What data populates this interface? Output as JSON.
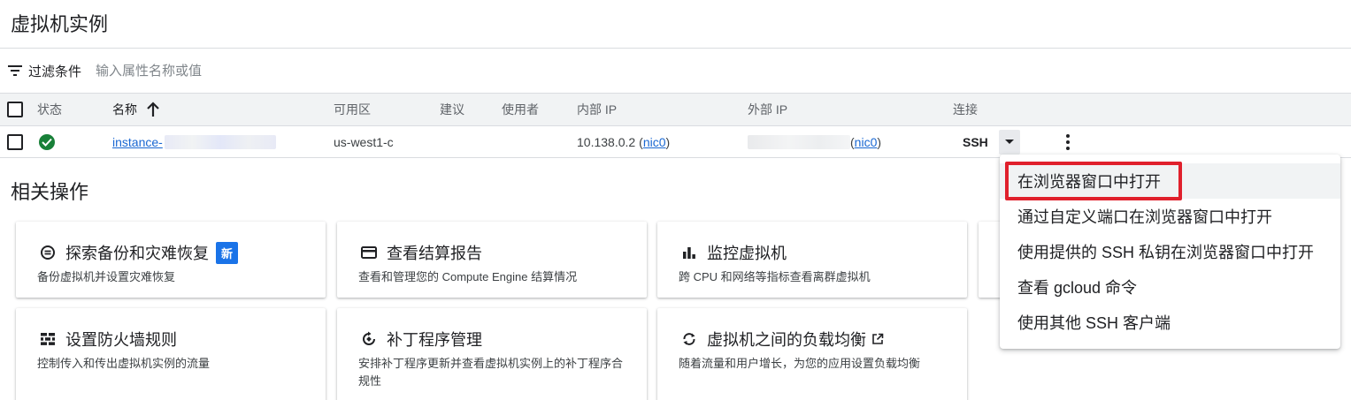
{
  "page": {
    "title": "虚拟机实例"
  },
  "filter": {
    "label": "过滤条件",
    "placeholder": "输入属性名称或值"
  },
  "table": {
    "headers": {
      "status": "状态",
      "name": "名称",
      "zone": "可用区",
      "recommendation": "建议",
      "in_use_by": "使用者",
      "internal_ip": "内部 IP",
      "external_ip": "外部 IP",
      "connect": "连接"
    },
    "rows": [
      {
        "name": "instance-",
        "zone": "us-west1-c",
        "internal_ip": "10.138.0.2",
        "internal_nic": "nic0",
        "external_nic": "nic0",
        "connect": "SSH"
      }
    ]
  },
  "related": {
    "title": "相关操作",
    "cards": [
      {
        "title": "探索备份和灾难恢复",
        "badge": "新",
        "desc": "备份虚拟机并设置灾难恢复",
        "icon": "backup-icon"
      },
      {
        "title": "查看结算报告",
        "desc": "查看和管理您的 Compute Engine 结算情况",
        "icon": "credit-card-icon"
      },
      {
        "title": "监控虚拟机",
        "desc": "跨 CPU 和网络等指标查看离群虚拟机",
        "icon": "bar-chart-icon"
      },
      {
        "title": "设置防火墙规则",
        "desc": "控制传入和传出虚拟机实例的流量",
        "icon": "firewall-icon"
      },
      {
        "title": "补丁程序管理",
        "desc": "安排补丁程序更新并查看虚拟机实例上的补丁程序合规性",
        "icon": "patch-icon"
      },
      {
        "title": "虚拟机之间的负载均衡",
        "desc": "随着流量和用户增长，为您的应用设置负载均衡",
        "icon": "load-balance-icon"
      }
    ]
  },
  "ssh_menu": {
    "items": [
      "在浏览器窗口中打开",
      "通过自定义端口在浏览器窗口中打开",
      "使用提供的 SSH 私钥在浏览器窗口中打开",
      "查看 gcloud 命令",
      "使用其他 SSH 客户端"
    ],
    "highlighted_index": 0
  },
  "colors": {
    "accent": "#1a73e8",
    "status_ok": "#188038",
    "highlight_border": "#e0202c",
    "header_bg": "#f1f3f4"
  }
}
